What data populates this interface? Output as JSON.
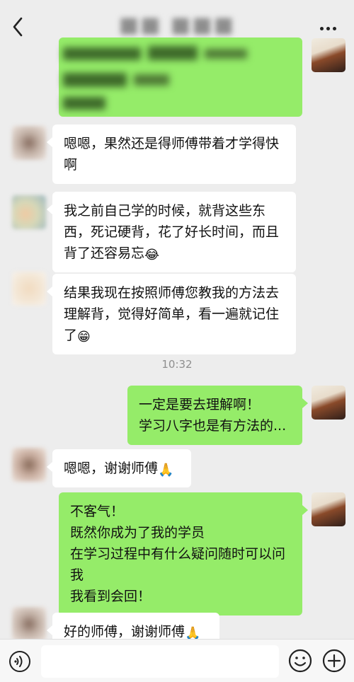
{
  "header": {
    "title_obscured": "■■ ■■■"
  },
  "messages": [
    {
      "side": "left",
      "text": "嗯嗯，果然还是得师傅带着才学得快啊"
    },
    {
      "side": "left",
      "text": "我之前自己学的时候，就背这些东西，死记硬背，花了好长时间，而且背了还容易忘",
      "emoji": "😂"
    },
    {
      "side": "left",
      "text": "结果我现在按照师傅您教我的方法去理解背，觉得好简单，看一遍就记住了",
      "emoji": "😁"
    },
    {
      "side": "time",
      "text": "10:32"
    },
    {
      "side": "right",
      "lines": [
        "一定是要去理解啊！",
        "学习八字也是有方法的..."
      ]
    },
    {
      "side": "left",
      "text": "嗯嗯，谢谢师傅",
      "emoji": "🙏"
    },
    {
      "side": "right",
      "lines": [
        "不客气！",
        "既然你成为了我的学员",
        "在学习过程中有什么疑问随时可以问我",
        "我看到会回！"
      ]
    },
    {
      "side": "left",
      "text": "好的师傅，谢谢师傅",
      "emoji": "🙏"
    }
  ],
  "colors": {
    "background": "#ededed",
    "bubble_right": "#95ec69",
    "bubble_left": "#ffffff"
  },
  "icons": {
    "back": "chevron-left-icon",
    "more": "more-dots-icon",
    "voice": "voice-icon",
    "emoji": "smile-icon",
    "plus": "plus-circle-icon"
  }
}
